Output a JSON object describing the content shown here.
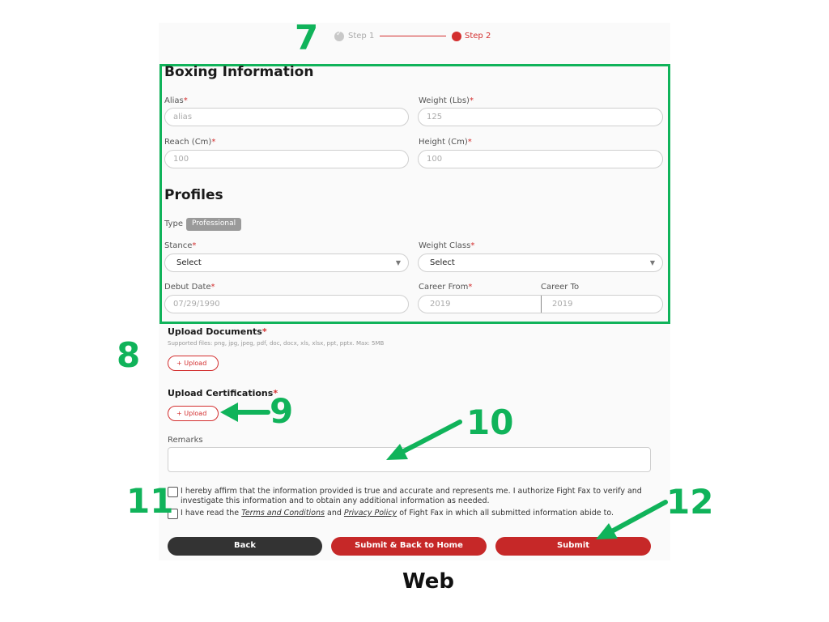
{
  "stepper": {
    "step1": "Step 1",
    "step2": "Step 2"
  },
  "boxing": {
    "title": "Boxing Information",
    "alias": {
      "label": "Alias",
      "placeholder": "alias"
    },
    "weight": {
      "label": "Weight (Lbs)",
      "placeholder": "125"
    },
    "reach": {
      "label": "Reach (Cm)",
      "placeholder": "100"
    },
    "height": {
      "label": "Height (Cm)",
      "placeholder": "100"
    }
  },
  "profiles": {
    "title": "Profiles",
    "type_label": "Type",
    "type_value": "Professional",
    "stance": {
      "label": "Stance",
      "value": "Select"
    },
    "weight_class": {
      "label": "Weight Class",
      "value": "Select"
    },
    "debut": {
      "label": "Debut Date",
      "placeholder": "07/29/1990"
    },
    "career_from": {
      "label": "Career From",
      "placeholder": "2019"
    },
    "career_to": {
      "label": "Career To",
      "placeholder": "2019"
    }
  },
  "upload_docs": {
    "title": "Upload Documents",
    "hint": "Supported files: png, jpg, jpeg, pdf, doc, docx, xls, xlsx, ppt, pptx. Max: 5MB",
    "button": "Upload"
  },
  "upload_certs": {
    "title": "Upload Certifications",
    "button": "Upload"
  },
  "remarks": {
    "label": "Remarks"
  },
  "consent": {
    "line1": "I hereby affirm that the information provided is true and accurate and represents me. I authorize Fight Fax to verify and",
    "line2": "investigate this information and to obtain any additional information as needed.",
    "terms_pre": "I have read the",
    "terms_link": "Terms and Conditions",
    "terms_and": "and",
    "privacy_link": "Privacy Policy",
    "terms_post": "of Fight Fax in which all submitted information abide to."
  },
  "buttons": {
    "back": "Back",
    "submit_home": "Submit & Back to Home",
    "submit": "Submit"
  },
  "annotations": {
    "n7": "7",
    "n8": "8",
    "n9": "9",
    "n10": "10",
    "n11": "11",
    "n12": "12"
  },
  "caption": "Web",
  "colors": {
    "accent": "#c62828",
    "annotation": "#10b35a"
  }
}
